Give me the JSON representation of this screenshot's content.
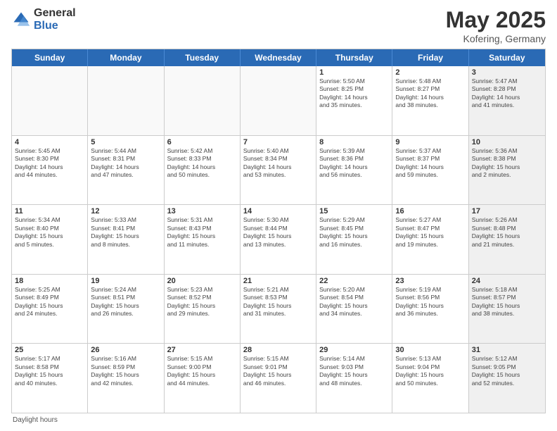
{
  "logo": {
    "general": "General",
    "blue": "Blue"
  },
  "title": {
    "month": "May 2025",
    "location": "Kofering, Germany"
  },
  "header_days": [
    "Sunday",
    "Monday",
    "Tuesday",
    "Wednesday",
    "Thursday",
    "Friday",
    "Saturday"
  ],
  "footer": "Daylight hours",
  "weeks": [
    [
      {
        "day": "",
        "info": "",
        "empty": true
      },
      {
        "day": "",
        "info": "",
        "empty": true
      },
      {
        "day": "",
        "info": "",
        "empty": true
      },
      {
        "day": "",
        "info": "",
        "empty": true
      },
      {
        "day": "1",
        "info": "Sunrise: 5:50 AM\nSunset: 8:25 PM\nDaylight: 14 hours\nand 35 minutes."
      },
      {
        "day": "2",
        "info": "Sunrise: 5:48 AM\nSunset: 8:27 PM\nDaylight: 14 hours\nand 38 minutes."
      },
      {
        "day": "3",
        "info": "Sunrise: 5:47 AM\nSunset: 8:28 PM\nDaylight: 14 hours\nand 41 minutes.",
        "shaded": true
      }
    ],
    [
      {
        "day": "4",
        "info": "Sunrise: 5:45 AM\nSunset: 8:30 PM\nDaylight: 14 hours\nand 44 minutes."
      },
      {
        "day": "5",
        "info": "Sunrise: 5:44 AM\nSunset: 8:31 PM\nDaylight: 14 hours\nand 47 minutes."
      },
      {
        "day": "6",
        "info": "Sunrise: 5:42 AM\nSunset: 8:33 PM\nDaylight: 14 hours\nand 50 minutes."
      },
      {
        "day": "7",
        "info": "Sunrise: 5:40 AM\nSunset: 8:34 PM\nDaylight: 14 hours\nand 53 minutes."
      },
      {
        "day": "8",
        "info": "Sunrise: 5:39 AM\nSunset: 8:36 PM\nDaylight: 14 hours\nand 56 minutes."
      },
      {
        "day": "9",
        "info": "Sunrise: 5:37 AM\nSunset: 8:37 PM\nDaylight: 14 hours\nand 59 minutes."
      },
      {
        "day": "10",
        "info": "Sunrise: 5:36 AM\nSunset: 8:38 PM\nDaylight: 15 hours\nand 2 minutes.",
        "shaded": true
      }
    ],
    [
      {
        "day": "11",
        "info": "Sunrise: 5:34 AM\nSunset: 8:40 PM\nDaylight: 15 hours\nand 5 minutes."
      },
      {
        "day": "12",
        "info": "Sunrise: 5:33 AM\nSunset: 8:41 PM\nDaylight: 15 hours\nand 8 minutes."
      },
      {
        "day": "13",
        "info": "Sunrise: 5:31 AM\nSunset: 8:43 PM\nDaylight: 15 hours\nand 11 minutes."
      },
      {
        "day": "14",
        "info": "Sunrise: 5:30 AM\nSunset: 8:44 PM\nDaylight: 15 hours\nand 13 minutes."
      },
      {
        "day": "15",
        "info": "Sunrise: 5:29 AM\nSunset: 8:45 PM\nDaylight: 15 hours\nand 16 minutes."
      },
      {
        "day": "16",
        "info": "Sunrise: 5:27 AM\nSunset: 8:47 PM\nDaylight: 15 hours\nand 19 minutes."
      },
      {
        "day": "17",
        "info": "Sunrise: 5:26 AM\nSunset: 8:48 PM\nDaylight: 15 hours\nand 21 minutes.",
        "shaded": true
      }
    ],
    [
      {
        "day": "18",
        "info": "Sunrise: 5:25 AM\nSunset: 8:49 PM\nDaylight: 15 hours\nand 24 minutes."
      },
      {
        "day": "19",
        "info": "Sunrise: 5:24 AM\nSunset: 8:51 PM\nDaylight: 15 hours\nand 26 minutes."
      },
      {
        "day": "20",
        "info": "Sunrise: 5:23 AM\nSunset: 8:52 PM\nDaylight: 15 hours\nand 29 minutes."
      },
      {
        "day": "21",
        "info": "Sunrise: 5:21 AM\nSunset: 8:53 PM\nDaylight: 15 hours\nand 31 minutes."
      },
      {
        "day": "22",
        "info": "Sunrise: 5:20 AM\nSunset: 8:54 PM\nDaylight: 15 hours\nand 34 minutes."
      },
      {
        "day": "23",
        "info": "Sunrise: 5:19 AM\nSunset: 8:56 PM\nDaylight: 15 hours\nand 36 minutes."
      },
      {
        "day": "24",
        "info": "Sunrise: 5:18 AM\nSunset: 8:57 PM\nDaylight: 15 hours\nand 38 minutes.",
        "shaded": true
      }
    ],
    [
      {
        "day": "25",
        "info": "Sunrise: 5:17 AM\nSunset: 8:58 PM\nDaylight: 15 hours\nand 40 minutes."
      },
      {
        "day": "26",
        "info": "Sunrise: 5:16 AM\nSunset: 8:59 PM\nDaylight: 15 hours\nand 42 minutes."
      },
      {
        "day": "27",
        "info": "Sunrise: 5:15 AM\nSunset: 9:00 PM\nDaylight: 15 hours\nand 44 minutes."
      },
      {
        "day": "28",
        "info": "Sunrise: 5:15 AM\nSunset: 9:01 PM\nDaylight: 15 hours\nand 46 minutes."
      },
      {
        "day": "29",
        "info": "Sunrise: 5:14 AM\nSunset: 9:03 PM\nDaylight: 15 hours\nand 48 minutes."
      },
      {
        "day": "30",
        "info": "Sunrise: 5:13 AM\nSunset: 9:04 PM\nDaylight: 15 hours\nand 50 minutes."
      },
      {
        "day": "31",
        "info": "Sunrise: 5:12 AM\nSunset: 9:05 PM\nDaylight: 15 hours\nand 52 minutes.",
        "shaded": true
      }
    ]
  ]
}
